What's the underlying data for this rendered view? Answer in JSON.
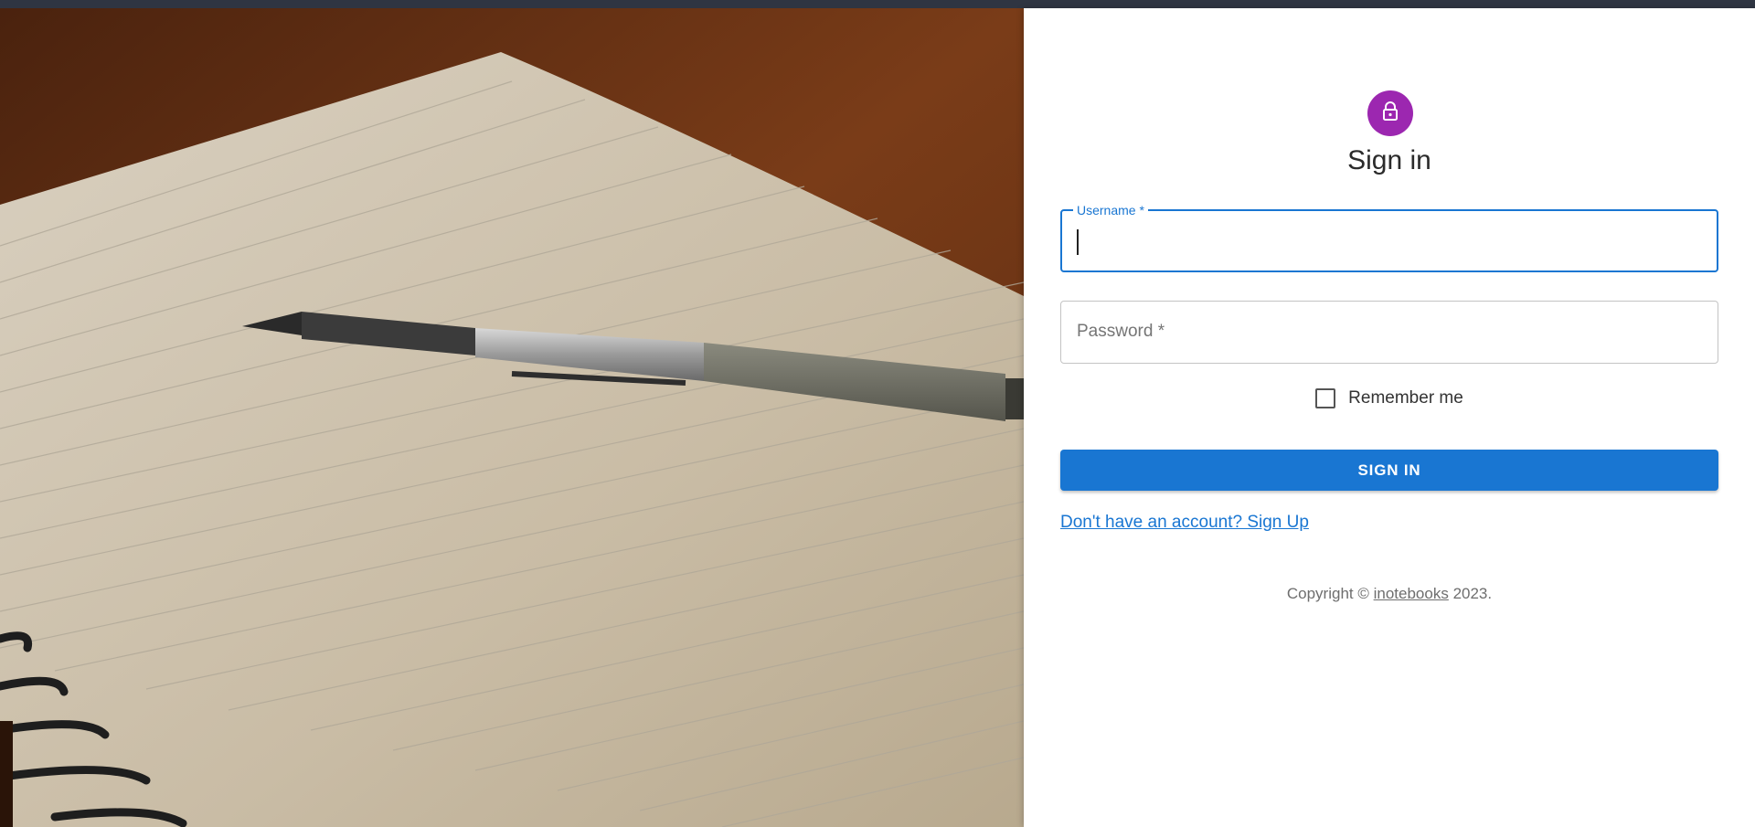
{
  "hero": {
    "image_name": "notebook-and-pen-photo"
  },
  "signin": {
    "icon": "lock-icon",
    "accent_color": "#9c27b0",
    "title": "Sign in",
    "username": {
      "label": "Username *",
      "value": ""
    },
    "password": {
      "placeholder": "Password *",
      "value": ""
    },
    "remember_label": "Remember me",
    "button_label": "SIGN IN",
    "button_color": "#1976d2",
    "signup_link": "Don't have an account? Sign Up"
  },
  "footer": {
    "prefix": "Copyright © ",
    "brand": "inotebooks",
    "suffix": " 2023."
  }
}
